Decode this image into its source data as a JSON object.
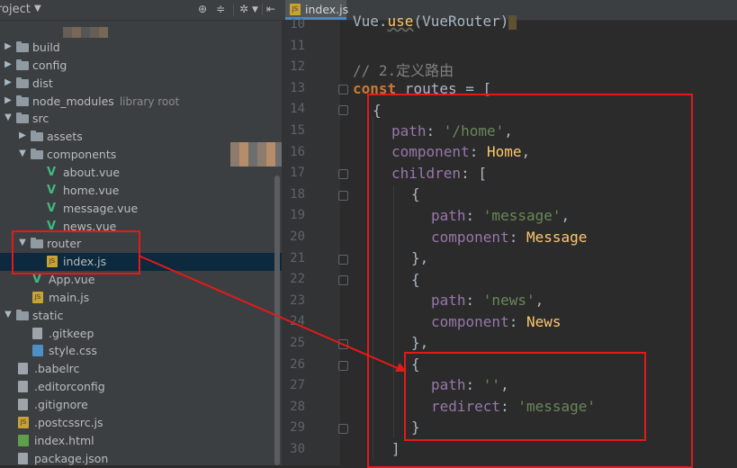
{
  "project_panel": {
    "title": "roject",
    "tree": [
      {
        "name": "build",
        "type": "folder",
        "level": 0,
        "expanded": false
      },
      {
        "name": "config",
        "type": "folder",
        "level": 0,
        "expanded": false
      },
      {
        "name": "dist",
        "type": "folder",
        "level": 0,
        "expanded": false
      },
      {
        "name": "node_modules",
        "extra": "library root",
        "type": "folder",
        "level": 0,
        "expanded": false
      },
      {
        "name": "src",
        "type": "folder",
        "level": 0,
        "expanded": true
      },
      {
        "name": "assets",
        "type": "folder",
        "level": 1,
        "expanded": false
      },
      {
        "name": "components",
        "type": "folder",
        "level": 1,
        "expanded": true
      },
      {
        "name": "about.vue",
        "type": "vue",
        "level": 2
      },
      {
        "name": "home.vue",
        "type": "vue",
        "level": 2
      },
      {
        "name": "message.vue",
        "type": "vue",
        "level": 2
      },
      {
        "name": "news.vue",
        "type": "vue",
        "level": 2
      },
      {
        "name": "router",
        "type": "folder",
        "level": 1,
        "expanded": true
      },
      {
        "name": "index.js",
        "type": "js",
        "level": 2,
        "selected": true
      },
      {
        "name": "App.vue",
        "type": "vue",
        "level": 1
      },
      {
        "name": "main.js",
        "type": "js",
        "level": 1
      },
      {
        "name": "static",
        "type": "folder",
        "level": 0,
        "expanded": true
      },
      {
        "name": ".gitkeep",
        "type": "file",
        "level": 1
      },
      {
        "name": "style.css",
        "type": "css",
        "level": 1
      },
      {
        "name": ".babelrc",
        "type": "file",
        "level": 0
      },
      {
        "name": ".editorconfig",
        "type": "file",
        "level": 0
      },
      {
        "name": ".gitignore",
        "type": "file",
        "level": 0
      },
      {
        "name": ".postcssrc.js",
        "type": "js",
        "level": 0
      },
      {
        "name": "index.html",
        "type": "html",
        "level": 0
      },
      {
        "name": "package.json",
        "type": "file",
        "level": 0
      }
    ]
  },
  "editor": {
    "tab_label": "index.js",
    "line_numbers": [
      "10",
      "11",
      "12",
      "13",
      "14",
      "15",
      "16",
      "17",
      "18",
      "19",
      "20",
      "21",
      "22",
      "23",
      "24",
      "25",
      "26",
      "27",
      "28",
      "29",
      "30"
    ],
    "code": {
      "l10": {
        "a": "Vue.",
        "b": "use",
        "c": "(VueRouter)"
      },
      "l12": "// 2.定义路由",
      "l13": {
        "kw": "const",
        "rest": " routes = ["
      },
      "l14": "{",
      "l15": {
        "prop": "path",
        "sep": ": ",
        "str": "'/home'",
        "end": ","
      },
      "l16": {
        "prop": "component",
        "sep": ": ",
        "val": "Home",
        "end": ","
      },
      "l17": {
        "prop": "children",
        "sep": ": ["
      },
      "l18": "{",
      "l19": {
        "prop": "path",
        "sep": ": ",
        "str": "'message'",
        "end": ","
      },
      "l20": {
        "prop": "component",
        "sep": ": ",
        "val": "Message"
      },
      "l21": "},",
      "l22": "{",
      "l23": {
        "prop": "path",
        "sep": ": ",
        "str": "'news'",
        "end": ","
      },
      "l24": {
        "prop": "component",
        "sep": ": ",
        "val": "News"
      },
      "l25": "},",
      "l26": "{",
      "l27": {
        "prop": "path",
        "sep": ": ",
        "str": "''",
        "end": ","
      },
      "l28": {
        "prop": "redirect",
        "sep": ": ",
        "str": "'message'"
      },
      "l29": "}",
      "l30": "]"
    }
  },
  "colors": {
    "annotation": "#e21a1a",
    "selection": "#0d293e",
    "keyword": "#cc7832",
    "property": "#9876aa",
    "string": "#6a8759"
  }
}
